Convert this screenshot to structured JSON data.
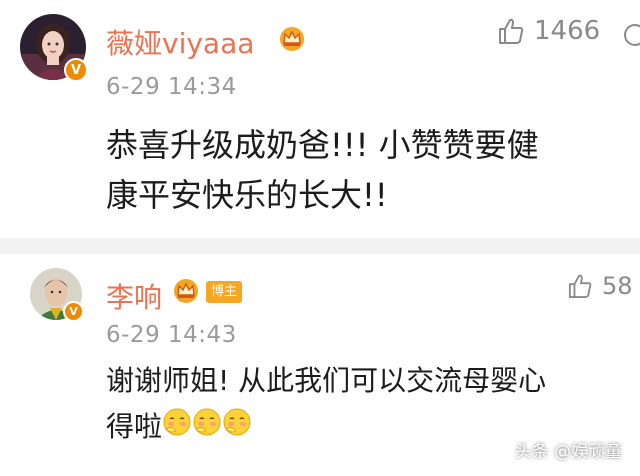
{
  "comments": [
    {
      "username": "薇娅viyaaa",
      "time": "6-29 14:34",
      "likes": "1466",
      "text_line1": "恭喜升级成奶爸!!! 小赞赞要健",
      "text_line2": "康平安快乐的长大!!",
      "verified_badge": "V",
      "avatar_icon": "woman-avatar",
      "crown_icon": "crown-icon"
    },
    {
      "username": "李响",
      "tag": "博主",
      "time": "6-29 14:43",
      "likes": "58",
      "text_line1": "谢谢师姐! 从此我们可以交流母婴心",
      "text_line2": "得啦",
      "verified_badge": "V",
      "avatar_icon": "man-avatar",
      "crown_icon": "crown-icon",
      "emoji": "shy-face-emoji"
    }
  ],
  "watermark": "头条 @娱顽童",
  "colors": {
    "username": "#eb7350",
    "time": "#9a9a9a",
    "divider": "#f2f2f2",
    "badge": "#f5a623",
    "verified": "#f08a00"
  }
}
